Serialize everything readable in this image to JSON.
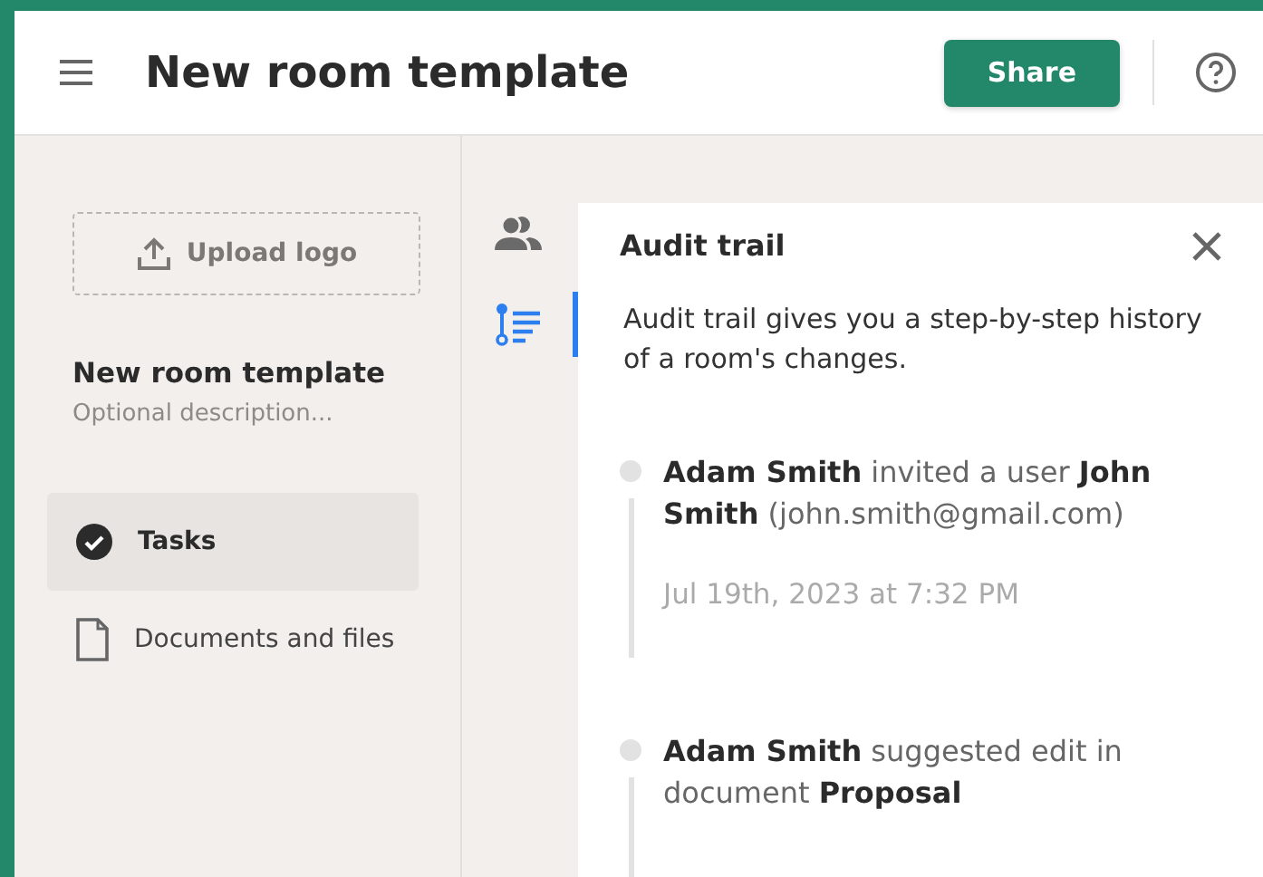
{
  "header": {
    "title": "New room template",
    "share_button": "Share"
  },
  "sidebar": {
    "upload_button": "Upload logo",
    "room_title": "New room template",
    "description_placeholder": "Optional description...",
    "items": [
      {
        "kind": "tasks",
        "label": "Tasks",
        "selected": true
      },
      {
        "kind": "documents",
        "label": "Documents and files",
        "selected": false
      }
    ]
  },
  "rail": [
    {
      "kind": "people",
      "selected": false
    },
    {
      "kind": "audit",
      "selected": true
    }
  ],
  "panel": {
    "title": "Audit trail",
    "description": "Audit trail gives you a step-by-step history of a room's changes.",
    "events": [
      {
        "text": "**Adam Smith** invited a user **John Smith** (john.smith@gmail.com)",
        "time": "Jul 19th, 2023 at 7:32 PM"
      },
      {
        "text": "**Adam Smith** suggested edit in document **Proposal**"
      }
    ]
  }
}
